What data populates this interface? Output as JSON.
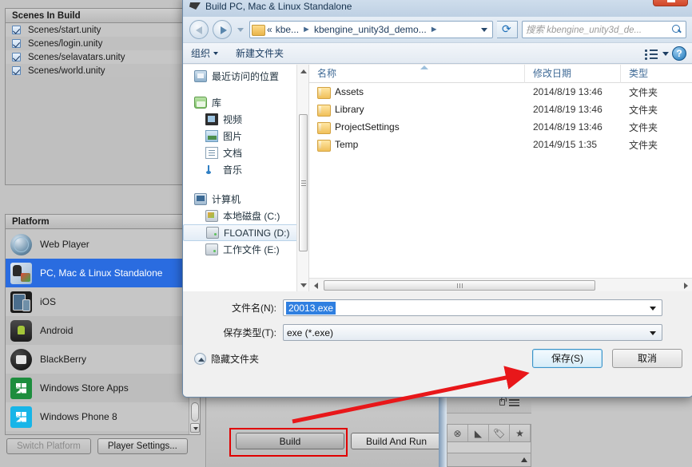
{
  "unity": {
    "scenes_panel": {
      "header": "Scenes In Build",
      "items": [
        {
          "label": "Scenes/start.unity",
          "checked": true
        },
        {
          "label": "Scenes/login.unity",
          "checked": true
        },
        {
          "label": "Scenes/selavatars.unity",
          "checked": true
        },
        {
          "label": "Scenes/world.unity",
          "checked": true
        }
      ]
    },
    "platform_panel": {
      "header": "Platform",
      "items": [
        {
          "label": "Web Player",
          "icon": "web-player-icon",
          "selected": false
        },
        {
          "label": "PC, Mac & Linux Standalone",
          "icon": "standalone-icon",
          "selected": true
        },
        {
          "label": "iOS",
          "icon": "ios-icon",
          "selected": false
        },
        {
          "label": "Android",
          "icon": "android-icon",
          "selected": false
        },
        {
          "label": "BlackBerry",
          "icon": "blackberry-icon",
          "selected": false
        },
        {
          "label": "Windows Store Apps",
          "icon": "windows-store-icon",
          "selected": false
        },
        {
          "label": "Windows Phone 8",
          "icon": "windows-phone-icon",
          "selected": false
        }
      ]
    },
    "switch_platform_label": "Switch Platform",
    "player_settings_label": "Player Settings...",
    "build_label": "Build",
    "build_and_run_label": "Build And Run",
    "annotation_color": "#e00000"
  },
  "dialog": {
    "title": "Build PC, Mac & Linux Standalone",
    "nav": {
      "back_tooltip": "后退",
      "forward_tooltip": "前进",
      "breadcrumb": [
        {
          "label": "«"
        },
        {
          "label": "kbe..."
        },
        {
          "label": "kbengine_unity3d_demo..."
        }
      ],
      "search_placeholder": "搜索 kbengine_unity3d_de..."
    },
    "commandbar": {
      "organize": "组织",
      "new_folder": "新建文件夹"
    },
    "tree": [
      {
        "label": "最近访问的位置",
        "icon": "recent-places-icon",
        "indent": 0,
        "selected": false
      },
      {
        "label": "库",
        "icon": "library-icon",
        "indent": 0,
        "selected": false
      },
      {
        "label": "视频",
        "icon": "videos-icon",
        "indent": 1,
        "selected": false
      },
      {
        "label": "图片",
        "icon": "pictures-icon",
        "indent": 1,
        "selected": false
      },
      {
        "label": "文档",
        "icon": "documents-icon",
        "indent": 1,
        "selected": false
      },
      {
        "label": "音乐",
        "icon": "music-icon",
        "indent": 1,
        "selected": false
      },
      {
        "label": "计算机",
        "icon": "computer-icon",
        "indent": 0,
        "selected": false
      },
      {
        "label": "本地磁盘 (C:)",
        "icon": "local-disk-icon",
        "indent": 1,
        "selected": false
      },
      {
        "label": "FLOATING (D:)",
        "icon": "drive-icon",
        "indent": 1,
        "selected": true
      },
      {
        "label": "工作文件 (E:)",
        "icon": "drive-icon",
        "indent": 1,
        "selected": false
      }
    ],
    "columns": {
      "name": "名称",
      "date": "修改日期",
      "type": "类型"
    },
    "files": [
      {
        "name": "Assets",
        "date": "2014/8/19 13:46",
        "type": "文件夹"
      },
      {
        "name": "Library",
        "date": "2014/8/19 13:46",
        "type": "文件夹"
      },
      {
        "name": "ProjectSettings",
        "date": "2014/8/19 13:46",
        "type": "文件夹"
      },
      {
        "name": "Temp",
        "date": "2014/9/15 1:35",
        "type": "文件夹"
      }
    ],
    "filename": {
      "label": "文件名(N):",
      "value": "20013.exe"
    },
    "filetype": {
      "label": "保存类型(T):",
      "value": "exe (*.exe)"
    },
    "hide_folders_label": "隐藏文件夹",
    "save_label": "保存(S)",
    "cancel_label": "取消",
    "accent_color": "#3c93c8",
    "selection_color": "#2f7fe0"
  }
}
